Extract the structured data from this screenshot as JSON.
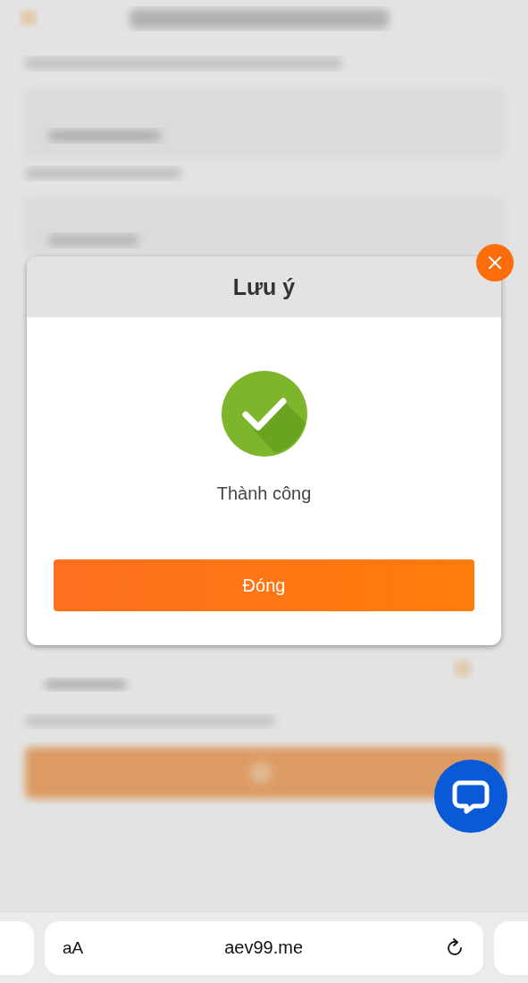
{
  "dialog": {
    "title": "Lưu ý",
    "message": "Thành công",
    "button": "Đóng"
  },
  "browser_bar": {
    "text_size_button": "aA",
    "url": "aev99.me"
  }
}
